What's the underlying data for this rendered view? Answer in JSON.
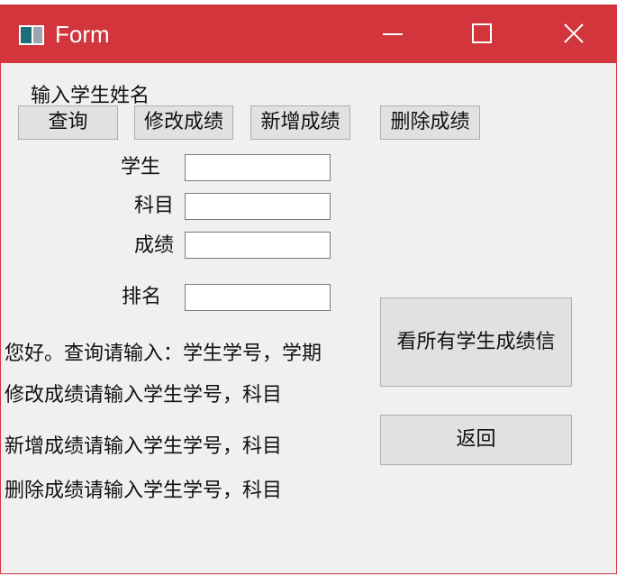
{
  "window": {
    "title": "Form",
    "accent_color": "#d2363c",
    "controls": {
      "minimize_icon": "minimize-icon",
      "maximize_icon": "maximize-icon",
      "close_icon": "close-icon"
    }
  },
  "form": {
    "name_prompt": "输入学生姓名",
    "buttons": {
      "query": "查询",
      "modify": "修改成绩",
      "add": "新增成绩",
      "delete": "删除成绩",
      "view_all": "看所有学生成绩信",
      "back": "返回"
    },
    "fields": {
      "student_id_label": "学生",
      "subject_label": "科目",
      "score_label": "成绩",
      "rank_label": "排名",
      "student_id_value": "",
      "subject_value": "",
      "score_value": "",
      "rank_value": ""
    },
    "instructions": [
      "您好。查询请输入：学生学号，学期",
      "修改成绩请输入学生学号，科目",
      "新增成绩请输入学生学号，科目",
      "删除成绩请输入学生学号，科目"
    ]
  }
}
